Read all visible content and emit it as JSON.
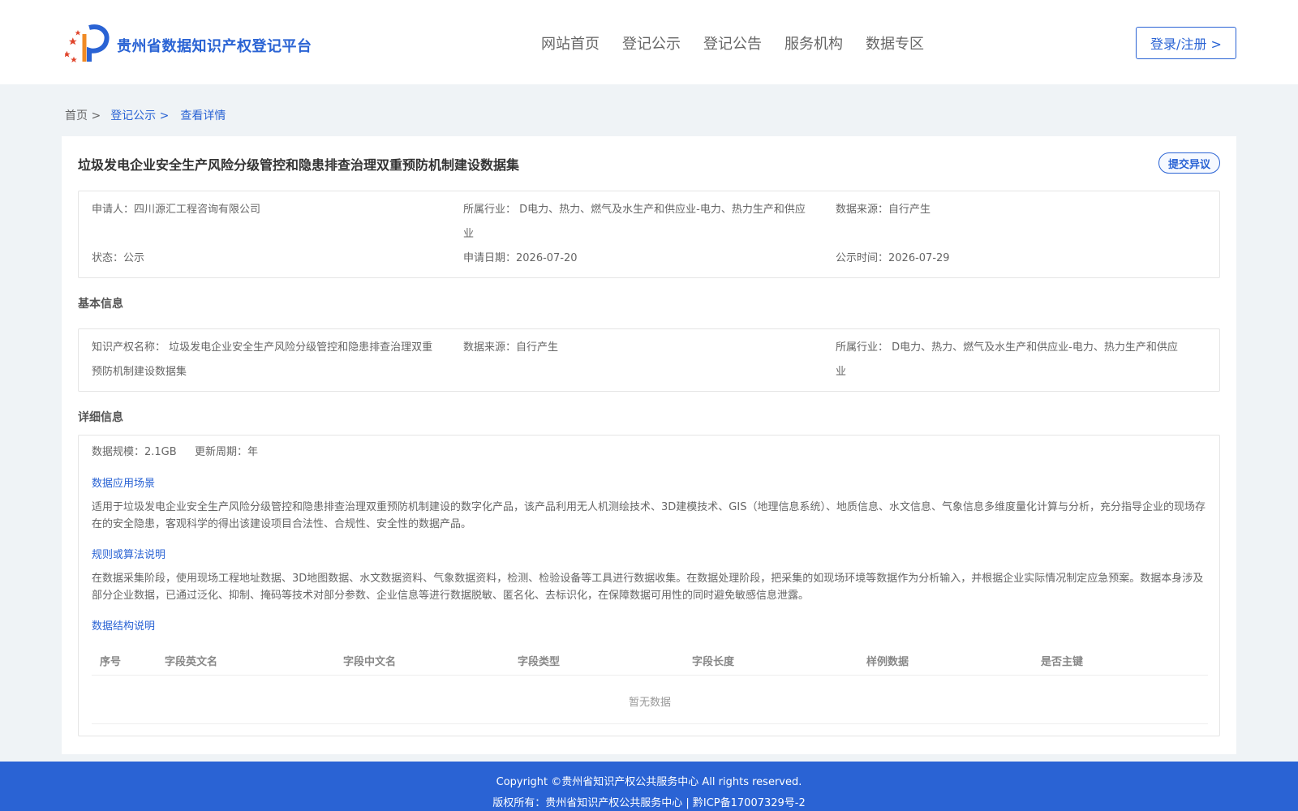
{
  "header": {
    "site_title": "贵州省数据知识产权登记平台",
    "nav": [
      "网站首页",
      "登记公示",
      "登记公告",
      "服务机构",
      "数据专区"
    ],
    "login_label": "登录/注册 >"
  },
  "breadcrumb": {
    "home": "首页 >",
    "section": "登记公示 >",
    "current": "查看详情"
  },
  "detail": {
    "title": "垃圾发电企业安全生产风险分级管控和隐患排查治理双重预防机制建设数据集",
    "objection_label": "提交异议",
    "summary": {
      "applicant": "申请人：四川源汇工程咨询有限公司",
      "industry_line1": "所属行业： D电力、热力、燃气及水生产和供应业-电力、热力生产和供应",
      "industry_line2": "业",
      "source": "数据来源：自行产生",
      "status": "状态：公示",
      "apply_date": "申请日期：2026-07-20",
      "publish_time": "公示时间：2026-07-29"
    },
    "basic": {
      "heading": "基本信息",
      "ip_name_line1": "知识产权名称： 垃圾发电企业安全生产风险分级管控和隐患排查治理双重",
      "ip_name_line2": "预防机制建设数据集",
      "source": "数据来源：自行产生",
      "industry_line1": "所属行业： D电力、热力、燃气及水生产和供应业-电力、热力生产和供应",
      "industry_line2": "业"
    },
    "details": {
      "heading": "详细信息",
      "scale": "数据规模：2.1GB",
      "cycle": "更新周期：年",
      "scenario_heading": "数据应用场景",
      "scenario_text": "适用于垃圾发电企业安全生产风险分级管控和隐患排查治理双重预防机制建设的数字化产品，该产品利用无人机测绘技术、3D建模技术、GIS（地理信息系统）、地质信息、水文信息、气象信息多维度量化计算与分析，充分指导企业的现场存在的安全隐患，客观科学的得出该建设项目合法性、合规性、安全性的数据产品。",
      "rules_heading": "规则或算法说明",
      "rules_text": "在数据采集阶段，使用现场工程地址数据、3D地图数据、水文数据资料、气象数据资料，检测、检验设备等工具进行数据收集。在数据处理阶段，把采集的如现场环境等数据作为分析输入，并根据企业实际情况制定应急预案。数据本身涉及部分企业数据，已通过泛化、抑制、掩码等技术对部分参数、企业信息等进行数据脱敏、匿名化、去标识化，在保障数据可用性的同时避免敏感信息泄露。",
      "structure_heading": "数据结构说明",
      "columns": [
        "序号",
        "字段英文名",
        "字段中文名",
        "字段类型",
        "字段长度",
        "样例数据",
        "是否主键"
      ],
      "empty_text": "暂无数据"
    }
  },
  "footer": {
    "copyright": "Copyright ©贵州省知识产权公共服务中心 All rights reserved.",
    "record": "版权所有：贵州省知识产权公共服务中心 | 黔ICP备17007329号-2"
  },
  "colors": {
    "brand": "#2a63d4",
    "logo_red": "#e0442b",
    "logo_orange": "#f08a24"
  }
}
